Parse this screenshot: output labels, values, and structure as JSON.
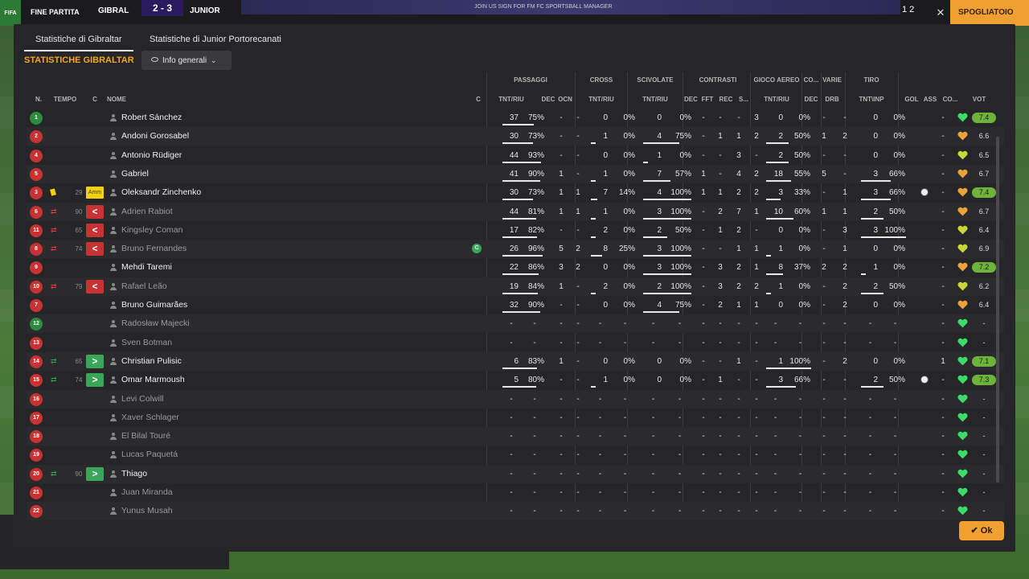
{
  "topbar": {
    "logo": "FIFA",
    "status": "FINE PARTITA",
    "home_team": "GIBRAL",
    "score": "2 - 3",
    "away_team": "JUNIOR",
    "ads": "JOIN US     SIGN FOR FM FC     SPORTSBALL MANAGER",
    "number": "1 2",
    "close_glyph": "✕",
    "orange_button": "SPOGLIATOIO"
  },
  "tabs": [
    "Statistiche di Gibraltar",
    "Statistiche di Junior Portorecanati"
  ],
  "section_title": "STATISTICHE GIBRALTAR",
  "dropdown_label": "Info generali",
  "headers": {
    "groups": [
      "PASSAGGI",
      "CROSS",
      "SCIVOLATE",
      "CONTRASTI",
      "GIOCO AEREO",
      "CO...",
      "VARIE",
      "TIRO"
    ],
    "cols": {
      "n": "N.",
      "tempo": "TEMPO",
      "c1": "C",
      "nome": "NOME",
      "c2": "C",
      "pass_tr": "TNT/RIU",
      "pass_dec": "DEC",
      "pass_ocn": "OCN",
      "cross_tr": "TNT/RIU",
      "sciv_tr": "TNT/RIU",
      "con_dec": "DEC",
      "con_fft": "FFT",
      "con_rec": "REC",
      "con_s": "S...",
      "aer_tr": "TNT/RIU",
      "co_dec": "DEC",
      "var_drb": "DRB",
      "tiro": "TNT\\INP",
      "gol": "GOL",
      "ass": "ASS",
      "co": "CO...",
      "vot": "VOT"
    }
  },
  "players": [
    {
      "n": "1",
      "gk": true,
      "name": "Robert Sánchez",
      "dim": false,
      "min": "",
      "sub": "",
      "amm": false,
      "cap": false,
      "pass_t": "37",
      "pass_p": "75%",
      "pass_bar": 0.75,
      "pass_dec": "-",
      "pass_ocn": "-",
      "cross_t": "0",
      "cross_p": "0%",
      "cross_bar": 0,
      "sciv_t": "0",
      "sciv_p": "0%",
      "sciv_bar": 0,
      "con_dec": "-",
      "con_fft": "-",
      "con_rec": "-",
      "con_s": "3",
      "aer_t": "0",
      "aer_p": "0%",
      "aer_bar": 0,
      "co_dec": "-",
      "drb": "-",
      "tiro_t": "0",
      "tiro_p": "0%",
      "tiro_bar": 0,
      "gol": "",
      "ass": "-",
      "heart": "#3ddc6a",
      "vote": "7.4",
      "vote_hi": true
    },
    {
      "n": "2",
      "name": "Andoni Gorosabel",
      "dim": false,
      "min": "",
      "sub": "",
      "pass_t": "30",
      "pass_p": "73%",
      "pass_bar": 0.73,
      "pass_dec": "-",
      "pass_ocn": "-",
      "cross_t": "1",
      "cross_p": "0%",
      "cross_bar": 0,
      "sciv_t": "4",
      "sciv_p": "75%",
      "sciv_bar": 0.75,
      "con_dec": "-",
      "con_fft": "1",
      "con_rec": "1",
      "con_s": "2",
      "aer_t": "2",
      "aer_p": "50%",
      "aer_bar": 0.5,
      "co_dec": "1",
      "drb": "2",
      "tiro_t": "0",
      "tiro_p": "0%",
      "tiro_bar": 0,
      "gol": "",
      "ass": "-",
      "heart": "#e8a43a",
      "vote": "6.6",
      "vote_hi": false
    },
    {
      "n": "4",
      "name": "Antonio Rüdiger",
      "dim": false,
      "min": "",
      "sub": "",
      "pass_t": "44",
      "pass_p": "93%",
      "pass_bar": 0.93,
      "pass_dec": "-",
      "pass_ocn": "-",
      "cross_t": "0",
      "cross_p": "0%",
      "cross_bar": 0,
      "sciv_t": "1",
      "sciv_p": "0%",
      "sciv_bar": 0,
      "con_dec": "-",
      "con_fft": "-",
      "con_rec": "3",
      "con_s": "-",
      "aer_t": "2",
      "aer_p": "50%",
      "aer_bar": 0.5,
      "co_dec": "-",
      "drb": "-",
      "tiro_t": "0",
      "tiro_p": "0%",
      "tiro_bar": 0,
      "gol": "",
      "ass": "-",
      "heart": "#c7d63a",
      "vote": "6.5",
      "vote_hi": false
    },
    {
      "n": "5",
      "name": "Gabriel",
      "dim": false,
      "min": "",
      "sub": "",
      "pass_t": "41",
      "pass_p": "90%",
      "pass_bar": 0.9,
      "pass_dec": "1",
      "pass_ocn": "-",
      "cross_t": "1",
      "cross_p": "0%",
      "cross_bar": 0,
      "sciv_t": "7",
      "sciv_p": "57%",
      "sciv_bar": 0.57,
      "con_dec": "1",
      "con_fft": "-",
      "con_rec": "4",
      "con_s": "2",
      "aer_t": "18",
      "aer_p": "55%",
      "aer_bar": 0.55,
      "co_dec": "5",
      "drb": "-",
      "tiro_t": "3",
      "tiro_p": "66%",
      "tiro_bar": 0.66,
      "gol": "",
      "ass": "-",
      "heart": "#e8a43a",
      "vote": "6.7",
      "vote_hi": false
    },
    {
      "n": "3",
      "name": "Oleksandr Zinchenko",
      "dim": false,
      "min": "29",
      "sub": "",
      "amm": true,
      "ycard": true,
      "pass_t": "30",
      "pass_p": "73%",
      "pass_bar": 0.73,
      "pass_dec": "1",
      "pass_ocn": "1",
      "cross_t": "7",
      "cross_p": "14%",
      "cross_bar": 0.14,
      "sciv_t": "4",
      "sciv_p": "100%",
      "sciv_bar": 1,
      "con_dec": "1",
      "con_fft": "1",
      "con_rec": "2",
      "con_s": "2",
      "aer_t": "3",
      "aer_p": "33%",
      "aer_bar": 0.33,
      "co_dec": "-",
      "drb": "1",
      "tiro_t": "3",
      "tiro_p": "66%",
      "tiro_bar": 0.66,
      "gol": "ball",
      "ass": "-",
      "heart": "#e8a43a",
      "vote": "7.4",
      "vote_hi": true
    },
    {
      "n": "6",
      "name": "Adrien Rabiot",
      "dim": true,
      "min": "90",
      "sub": "out",
      "pass_t": "44",
      "pass_p": "81%",
      "pass_bar": 0.81,
      "pass_dec": "1",
      "pass_ocn": "1",
      "cross_t": "1",
      "cross_p": "0%",
      "cross_bar": 0,
      "sciv_t": "3",
      "sciv_p": "100%",
      "sciv_bar": 1,
      "con_dec": "-",
      "con_fft": "2",
      "con_rec": "7",
      "con_s": "1",
      "aer_t": "10",
      "aer_p": "60%",
      "aer_bar": 0.6,
      "co_dec": "1",
      "drb": "1",
      "tiro_t": "2",
      "tiro_p": "50%",
      "tiro_bar": 0.5,
      "gol": "",
      "ass": "-",
      "heart": "#e8a43a",
      "vote": "6.7",
      "vote_hi": false
    },
    {
      "n": "11",
      "name": "Kingsley Coman",
      "dim": true,
      "min": "65",
      "sub": "out",
      "pass_t": "17",
      "pass_p": "82%",
      "pass_bar": 0.82,
      "pass_dec": "-",
      "pass_ocn": "-",
      "cross_t": "2",
      "cross_p": "0%",
      "cross_bar": 0,
      "sciv_t": "2",
      "sciv_p": "50%",
      "sciv_bar": 0.5,
      "con_dec": "-",
      "con_fft": "1",
      "con_rec": "2",
      "con_s": "-",
      "aer_t": "0",
      "aer_p": "0%",
      "aer_bar": 0,
      "co_dec": "-",
      "drb": "3",
      "tiro_t": "3",
      "tiro_p": "100%",
      "tiro_bar": 1,
      "gol": "",
      "ass": "-",
      "heart": "#c7d63a",
      "vote": "6.4",
      "vote_hi": false
    },
    {
      "n": "8",
      "name": "Bruno Fernandes",
      "dim": true,
      "min": "74",
      "sub": "out",
      "cap": true,
      "pass_t": "26",
      "pass_p": "96%",
      "pass_bar": 0.96,
      "pass_dec": "5",
      "pass_ocn": "2",
      "cross_t": "8",
      "cross_p": "25%",
      "cross_bar": 0.25,
      "sciv_t": "3",
      "sciv_p": "100%",
      "sciv_bar": 1,
      "con_dec": "-",
      "con_fft": "-",
      "con_rec": "1",
      "con_s": "1",
      "aer_t": "1",
      "aer_p": "0%",
      "aer_bar": 0,
      "co_dec": "-",
      "drb": "1",
      "tiro_t": "0",
      "tiro_p": "0%",
      "tiro_bar": 0,
      "gol": "",
      "ass": "-",
      "heart": "#c7d63a",
      "vote": "6.9",
      "vote_hi": false
    },
    {
      "n": "9",
      "name": "Mehdi Taremi",
      "dim": false,
      "min": "",
      "sub": "",
      "pass_t": "22",
      "pass_p": "86%",
      "pass_bar": 0.86,
      "pass_dec": "3",
      "pass_ocn": "2",
      "cross_t": "0",
      "cross_p": "0%",
      "cross_bar": 0,
      "sciv_t": "3",
      "sciv_p": "100%",
      "sciv_bar": 1,
      "con_dec": "-",
      "con_fft": "3",
      "con_rec": "2",
      "con_s": "1",
      "aer_t": "8",
      "aer_p": "37%",
      "aer_bar": 0.37,
      "co_dec": "2",
      "drb": "2",
      "tiro_t": "1",
      "tiro_p": "0%",
      "tiro_bar": 0,
      "gol": "",
      "ass": "-",
      "heart": "#e8a43a",
      "vote": "7.2",
      "vote_hi": true
    },
    {
      "n": "10",
      "name": "Rafael Leão",
      "dim": true,
      "min": "79",
      "sub": "out",
      "pass_t": "19",
      "pass_p": "84%",
      "pass_bar": 0.84,
      "pass_dec": "1",
      "pass_ocn": "-",
      "cross_t": "2",
      "cross_p": "0%",
      "cross_bar": 0,
      "sciv_t": "2",
      "sciv_p": "100%",
      "sciv_bar": 1,
      "con_dec": "-",
      "con_fft": "3",
      "con_rec": "2",
      "con_s": "2",
      "aer_t": "1",
      "aer_p": "0%",
      "aer_bar": 0,
      "co_dec": "-",
      "drb": "2",
      "tiro_t": "2",
      "tiro_p": "50%",
      "tiro_bar": 0.5,
      "gol": "",
      "ass": "-",
      "heart": "#c7d63a",
      "vote": "6.2",
      "vote_hi": false
    },
    {
      "n": "7",
      "name": "Bruno Guimarães",
      "dim": false,
      "min": "",
      "sub": "",
      "pass_t": "32",
      "pass_p": "90%",
      "pass_bar": 0.9,
      "pass_dec": "-",
      "pass_ocn": "-",
      "cross_t": "0",
      "cross_p": "0%",
      "cross_bar": 0,
      "sciv_t": "4",
      "sciv_p": "75%",
      "sciv_bar": 0.75,
      "con_dec": "-",
      "con_fft": "2",
      "con_rec": "1",
      "con_s": "1",
      "aer_t": "0",
      "aer_p": "0%",
      "aer_bar": 0,
      "co_dec": "-",
      "drb": "2",
      "tiro_t": "0",
      "tiro_p": "0%",
      "tiro_bar": 0,
      "gol": "",
      "ass": "-",
      "heart": "#e8a43a",
      "vote": "6.4",
      "vote_hi": false
    },
    {
      "n": "12",
      "gk": true,
      "name": "Radosław Majecki",
      "dim": true,
      "empty": true,
      "heart": "#3ddc6a",
      "vote": "-"
    },
    {
      "n": "13",
      "name": "Sven Botman",
      "dim": true,
      "empty": true,
      "heart": "#3ddc6a",
      "vote": "-"
    },
    {
      "n": "14",
      "name": "Christian Pulisic",
      "dim": false,
      "min": "65",
      "sub": "in",
      "pass_t": "6",
      "pass_p": "83%",
      "pass_bar": 0.83,
      "pass_dec": "1",
      "pass_ocn": "-",
      "cross_t": "0",
      "cross_p": "0%",
      "cross_bar": 0,
      "sciv_t": "0",
      "sciv_p": "0%",
      "sciv_bar": 0,
      "con_dec": "-",
      "con_fft": "-",
      "con_rec": "1",
      "con_s": "-",
      "aer_t": "1",
      "aer_p": "100%",
      "aer_bar": 1,
      "co_dec": "-",
      "drb": "2",
      "tiro_t": "0",
      "tiro_p": "0%",
      "tiro_bar": 0,
      "gol": "1",
      "ass": "",
      "heart": "#3ddc6a",
      "vote": "7.1",
      "vote_hi": true
    },
    {
      "n": "15",
      "name": "Omar Marmoush",
      "dim": false,
      "min": "74",
      "sub": "in",
      "pass_t": "5",
      "pass_p": "80%",
      "pass_bar": 0.8,
      "pass_dec": "-",
      "pass_ocn": "-",
      "cross_t": "1",
      "cross_p": "0%",
      "cross_bar": 0,
      "sciv_t": "0",
      "sciv_p": "0%",
      "sciv_bar": 0,
      "con_dec": "-",
      "con_fft": "1",
      "con_rec": "-",
      "con_s": "-",
      "aer_t": "3",
      "aer_p": "66%",
      "aer_bar": 0.66,
      "co_dec": "-",
      "drb": "-",
      "tiro_t": "2",
      "tiro_p": "50%",
      "tiro_bar": 0.5,
      "gol": "ball",
      "ass": "-",
      "heart": "#3ddc6a",
      "vote": "7.3",
      "vote_hi": true
    },
    {
      "n": "16",
      "name": "Levi Colwill",
      "dim": true,
      "empty": true,
      "heart": "#3ddc6a",
      "vote": "-"
    },
    {
      "n": "17",
      "name": "Xaver Schlager",
      "dim": true,
      "empty": true,
      "heart": "#3ddc6a",
      "vote": "-"
    },
    {
      "n": "18",
      "name": "El Bilal Touré",
      "dim": true,
      "empty": true,
      "heart": "#3ddc6a",
      "vote": "-"
    },
    {
      "n": "19",
      "name": "Lucas Paquetá",
      "dim": true,
      "empty": true,
      "heart": "#3ddc6a",
      "vote": "-"
    },
    {
      "n": "20",
      "name": "Thiago",
      "dim": false,
      "min": "90",
      "sub": "in",
      "empty": true,
      "heart": "#3ddc6a",
      "vote": "-"
    },
    {
      "n": "21",
      "name": "Juan Miranda",
      "dim": true,
      "empty": true,
      "heart": "#3ddc6a",
      "vote": "-"
    },
    {
      "n": "22",
      "name": "Yunus Musah",
      "dim": true,
      "empty": true,
      "heart": "#3ddc6a",
      "vote": "-"
    }
  ],
  "amm_label": "Amm",
  "cap_label": "C",
  "sub_out_glyph": "<",
  "sub_in_glyph": ">",
  "dash": "-",
  "ok_button": "Ok",
  "ok_check": "✔"
}
